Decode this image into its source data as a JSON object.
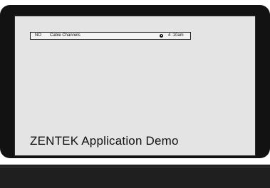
{
  "channel_bar": {
    "channel_number": "NO",
    "channel_name": "Cable Channels",
    "clock_icon": "clock-icon",
    "time": "4 :10am"
  },
  "app_title": "ZENTEK Application Demo",
  "colors": {
    "bezel": "#121212",
    "screen": "#e4e4e4",
    "stand": "#1f1f1f"
  }
}
